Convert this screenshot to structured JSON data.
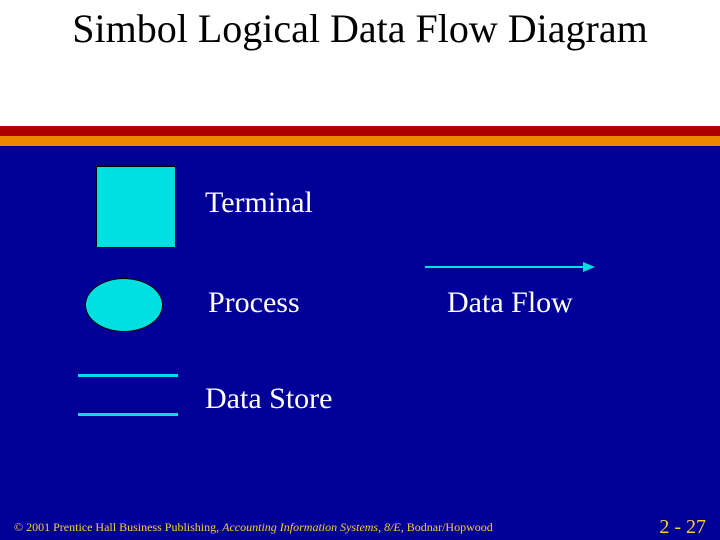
{
  "title": "Simbol Logical Data Flow Diagram",
  "symbols": {
    "terminal": "Terminal",
    "process": "Process",
    "datastore": "Data Store",
    "dataflow": "Data Flow"
  },
  "footer": {
    "copyright": "© 2001 Prentice Hall Business Publishing, ",
    "book_title": "Accounting Information Systems, 8/E",
    "authors": ", Bodnar/Hopwood",
    "page": "2 - 27"
  }
}
